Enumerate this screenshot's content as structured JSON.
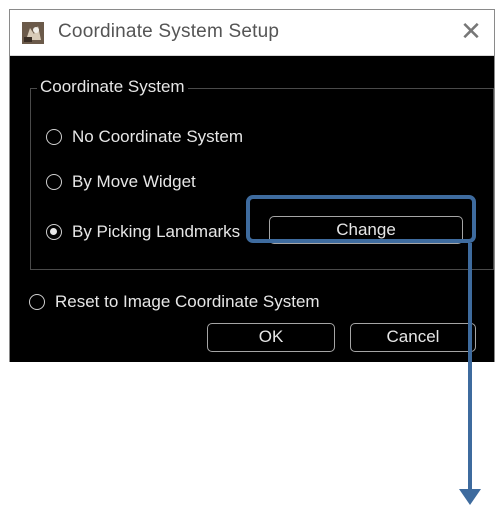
{
  "window": {
    "title": "Coordinate System Setup",
    "close_glyph": "✕"
  },
  "group": {
    "title": "Coordinate System"
  },
  "options": [
    {
      "label": "No Coordinate System",
      "checked": false
    },
    {
      "label": "By Move Widget",
      "checked": false
    },
    {
      "label": "By Picking Landmarks",
      "checked": true
    }
  ],
  "reset_option": {
    "label": "Reset to Image Coordinate System",
    "checked": false
  },
  "buttons": {
    "change": "Change",
    "ok": "OK",
    "cancel": "Cancel"
  },
  "annotation": {
    "color": "#3e6b9e",
    "highlight_target": "change-button"
  }
}
